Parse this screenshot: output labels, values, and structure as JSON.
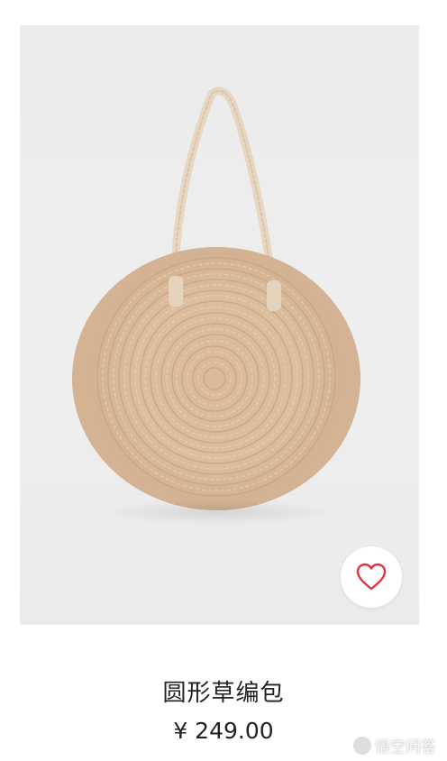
{
  "product": {
    "name": "圆形草编包",
    "price": "¥ 249.00",
    "image_icon": "straw-bag-image"
  },
  "wishlist": {
    "icon": "heart-icon",
    "color": "#e0343f"
  },
  "watermark": {
    "text": "悟空问答"
  }
}
